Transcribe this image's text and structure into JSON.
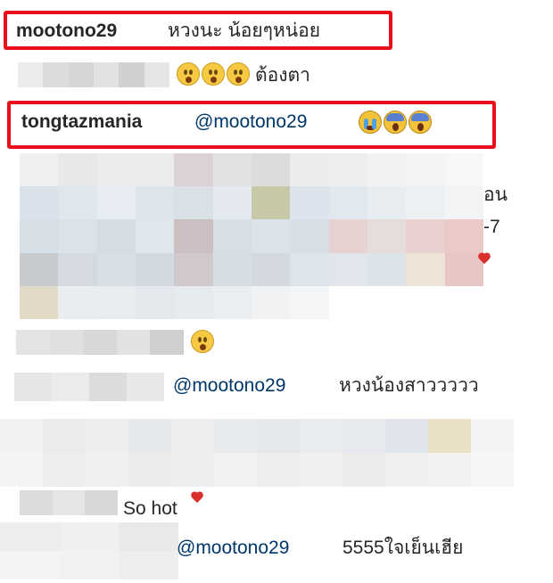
{
  "comments": [
    {
      "username": "mootono29",
      "text": "หวงนะ น้อยๆหน่อย"
    },
    {
      "text": "ต้องตา"
    },
    {
      "username": "tongtazmania",
      "mention": "@mootono29"
    },
    {
      "text_fragments": [
        "อน",
        "-7"
      ]
    },
    {
      "mention": "@mootono29",
      "text": "หวงน้องสาววววว"
    },
    {
      "text": "So hot"
    },
    {
      "mention": "@mootono29",
      "text": "5555ใจเย็นเฮีย"
    }
  ],
  "colors": {
    "highlight": "#e8101a",
    "mention": "#00376b",
    "text": "#262626"
  },
  "icons": [
    "shocked-face-emoji",
    "screaming-face-emoji",
    "crying-face-emoji",
    "red-heart-emoji"
  ]
}
